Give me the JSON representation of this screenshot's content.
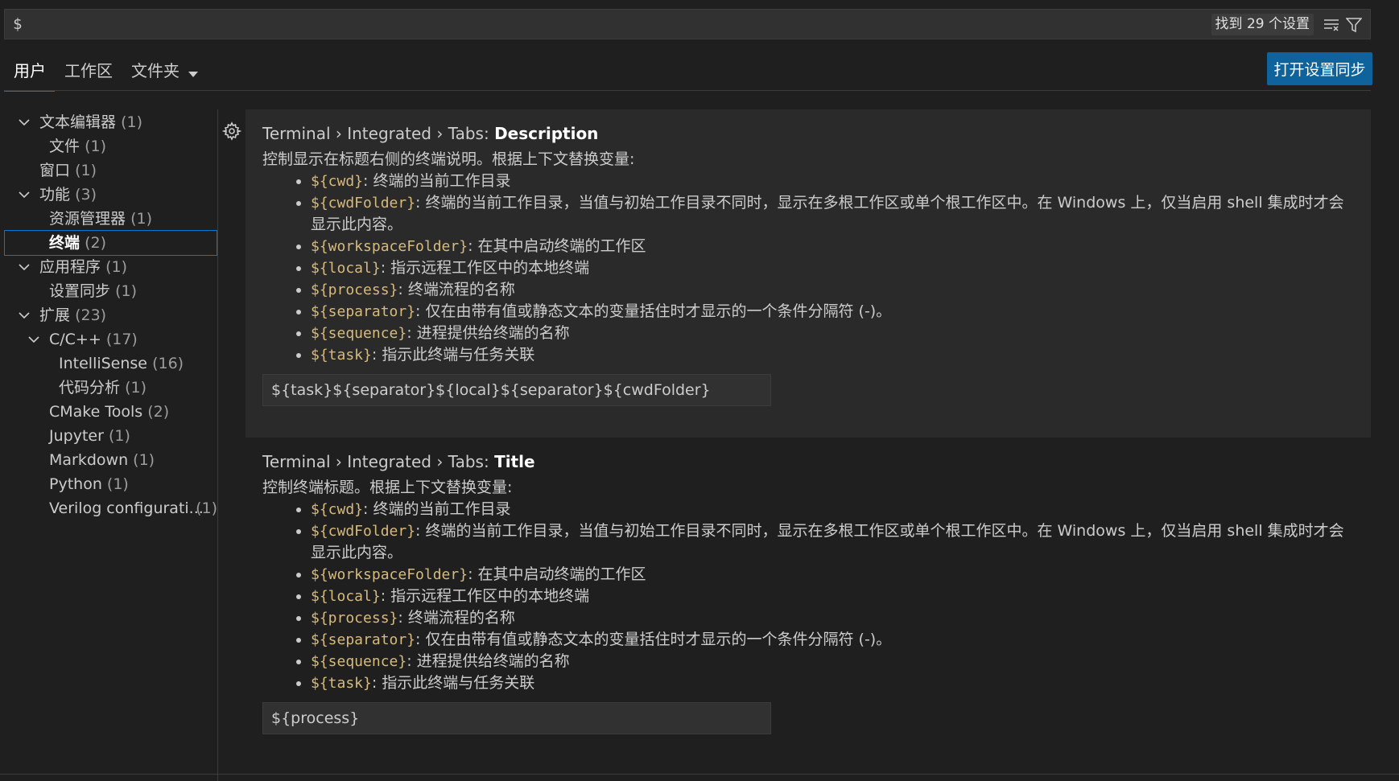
{
  "search": {
    "value": "$",
    "result_count": "找到 29 个设置"
  },
  "tabs": {
    "user": "用户",
    "workspace": "工作区",
    "folder": "文件夹"
  },
  "sync_button": "打开设置同步",
  "toc": [
    {
      "label": "文本编辑器",
      "count": "(1)"
    },
    {
      "label": "文件",
      "count": "(1)"
    },
    {
      "label": "窗口",
      "count": "(1)"
    },
    {
      "label": "功能",
      "count": "(3)"
    },
    {
      "label": "资源管理器",
      "count": "(1)"
    },
    {
      "label": "终端",
      "count": "(2)"
    },
    {
      "label": "应用程序",
      "count": "(1)"
    },
    {
      "label": "设置同步",
      "count": "(1)"
    },
    {
      "label": "扩展",
      "count": "(23)"
    },
    {
      "label": "C/C++",
      "count": "(17)"
    },
    {
      "label": "IntelliSense",
      "count": "(16)"
    },
    {
      "label": "代码分析",
      "count": "(1)"
    },
    {
      "label": "CMake Tools",
      "count": "(2)"
    },
    {
      "label": "Jupyter",
      "count": "(1)"
    },
    {
      "label": "Markdown",
      "count": "(1)"
    },
    {
      "label": "Python",
      "count": "(1)"
    },
    {
      "label": "Verilog configurati...",
      "count": "(1)"
    }
  ],
  "settings": [
    {
      "category": "Terminal › Integrated › Tabs: ",
      "key": "Description",
      "description": "控制显示在标题右侧的终端说明。根据上下文替换变量:",
      "items": [
        {
          "var": "${cwd}",
          "text": ": 终端的当前工作目录"
        },
        {
          "var": "${cwdFolder}",
          "text": ": 终端的当前工作目录，当值与初始工作目录不同时，显示在多根工作区或单个根工作区中。在 Windows 上，仅当启用 shell 集成时才会显示此内容。"
        },
        {
          "var": "${workspaceFolder}",
          "text": ": 在其中启动终端的工作区"
        },
        {
          "var": "${local}",
          "text": ": 指示远程工作区中的本地终端"
        },
        {
          "var": "${process}",
          "text": ": 终端流程的名称"
        },
        {
          "var": "${separator}",
          "text": ": 仅在由带有值或静态文本的变量括住时才显示的一个条件分隔符 (-)。"
        },
        {
          "var": "${sequence}",
          "text": ": 进程提供给终端的名称"
        },
        {
          "var": "${task}",
          "text": ": 指示此终端与任务关联"
        }
      ],
      "value": "${task}${separator}${local}${separator}${cwdFolder}"
    },
    {
      "category": "Terminal › Integrated › Tabs: ",
      "key": "Title",
      "description": "控制终端标题。根据上下文替换变量:",
      "items": [
        {
          "var": "${cwd}",
          "text": ": 终端的当前工作目录"
        },
        {
          "var": "${cwdFolder}",
          "text": ": 终端的当前工作目录，当值与初始工作目录不同时，显示在多根工作区或单个根工作区中。在 Windows 上，仅当启用 shell 集成时才会显示此内容。"
        },
        {
          "var": "${workspaceFolder}",
          "text": ": 在其中启动终端的工作区"
        },
        {
          "var": "${local}",
          "text": ": 指示远程工作区中的本地终端"
        },
        {
          "var": "${process}",
          "text": ": 终端流程的名称"
        },
        {
          "var": "${separator}",
          "text": ": 仅在由带有值或静态文本的变量括住时才显示的一个条件分隔符 (-)。"
        },
        {
          "var": "${sequence}",
          "text": ": 进程提供给终端的名称"
        },
        {
          "var": "${task}",
          "text": ": 指示此终端与任务关联"
        }
      ],
      "value": "${process}"
    }
  ]
}
